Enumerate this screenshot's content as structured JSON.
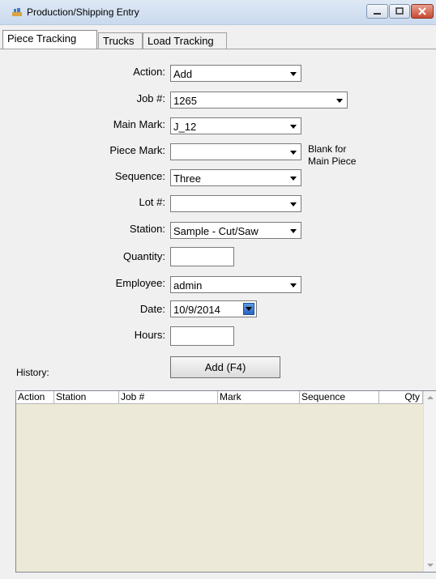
{
  "window": {
    "title": "Production/Shipping Entry"
  },
  "tabs": [
    {
      "label": "Piece Tracking"
    },
    {
      "label": "Trucks"
    },
    {
      "label": "Load Tracking"
    }
  ],
  "form": {
    "action": {
      "label": "Action:",
      "value": "Add"
    },
    "job": {
      "label": "Job #:",
      "value": "1265"
    },
    "main_mark": {
      "label": "Main Mark:",
      "value": "J_12"
    },
    "piece_mark": {
      "label": "Piece Mark:",
      "value": "",
      "hint_line1": "Blank for",
      "hint_line2": "Main Piece"
    },
    "sequence": {
      "label": "Sequence:",
      "value": "Three"
    },
    "lot": {
      "label": "Lot #:",
      "value": ""
    },
    "station": {
      "label": "Station:",
      "value": "Sample - Cut/Saw"
    },
    "quantity": {
      "label": "Quantity:",
      "value": ""
    },
    "employee": {
      "label": "Employee:",
      "value": "admin"
    },
    "date": {
      "label": "Date:",
      "value": "10/9/2014"
    },
    "hours": {
      "label": "Hours:",
      "value": ""
    },
    "add_button": "Add (F4)"
  },
  "history": {
    "label": "History:",
    "columns": [
      "Action",
      "Station",
      "Job #",
      "Mark",
      "Sequence",
      "Qty"
    ],
    "rows": []
  }
}
